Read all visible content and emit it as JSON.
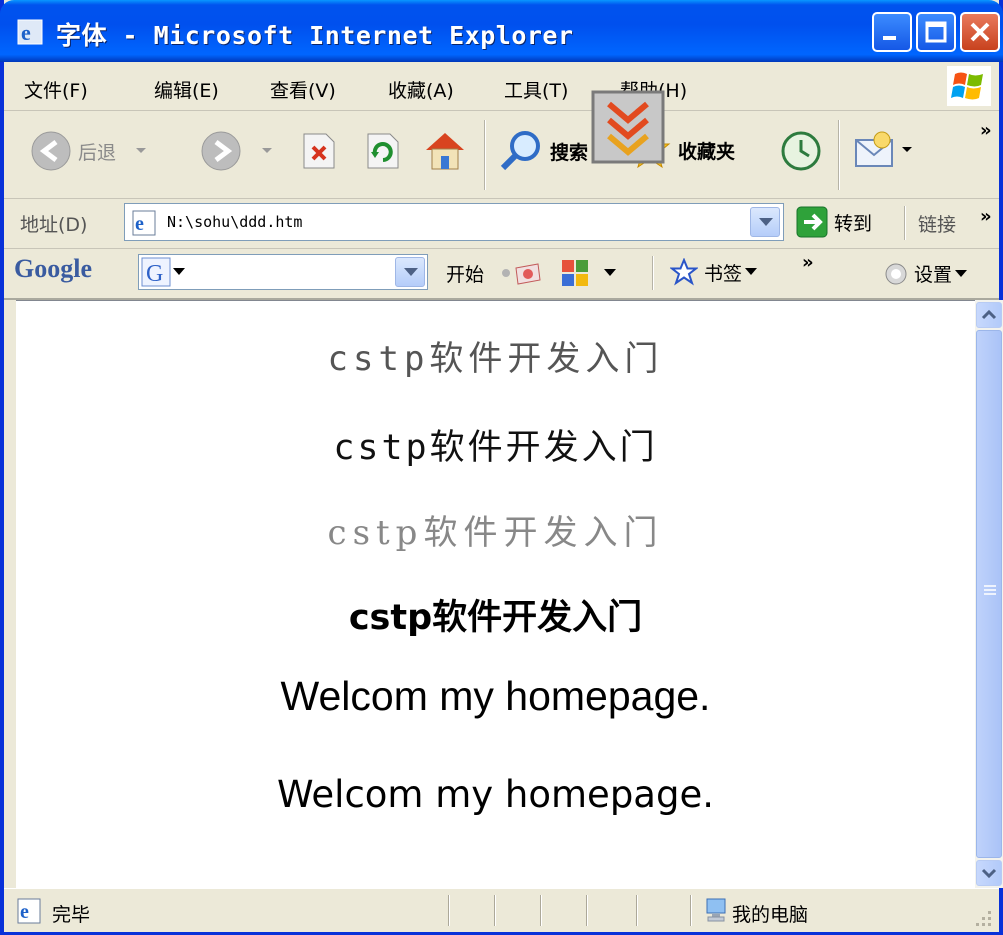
{
  "window": {
    "title": "字体 - Microsoft Internet Explorer",
    "minimize_icon": "minimize-icon",
    "maximize_icon": "maximize-icon",
    "close_icon": "close-icon"
  },
  "menubar": {
    "items": [
      {
        "label": "文件(F)"
      },
      {
        "label": "编辑(E)"
      },
      {
        "label": "查看(V)"
      },
      {
        "label": "收藏(A)"
      },
      {
        "label": "工具(T)"
      },
      {
        "label": "帮助(H)"
      }
    ]
  },
  "toolbar": {
    "back_label": "后退",
    "search_label": "搜索",
    "favorites_label": "收藏夹",
    "chevron": "»"
  },
  "addressbar": {
    "label": "地址(D)",
    "value": "N:\\sohu\\ddd.htm",
    "go_label": "转到",
    "links_label": "链接",
    "chevron": "»"
  },
  "googlebar": {
    "logo": "Google",
    "start_label": "开始",
    "bookmarks_label": "书签",
    "chevron": "»",
    "settings_label": "设置"
  },
  "content": {
    "lines": [
      "cstp软件开发入门",
      "cstp软件开发入门",
      "cstp软件开发入门",
      "cstp软件开发入门",
      "Welcom my homepage.",
      "Welcom my homepage."
    ]
  },
  "statusbar": {
    "status": "完毕",
    "zone": "我的电脑"
  },
  "colors": {
    "titlebar": "#0053ee",
    "close_button": "#c8421e",
    "window_bg": "#ece9d8"
  }
}
